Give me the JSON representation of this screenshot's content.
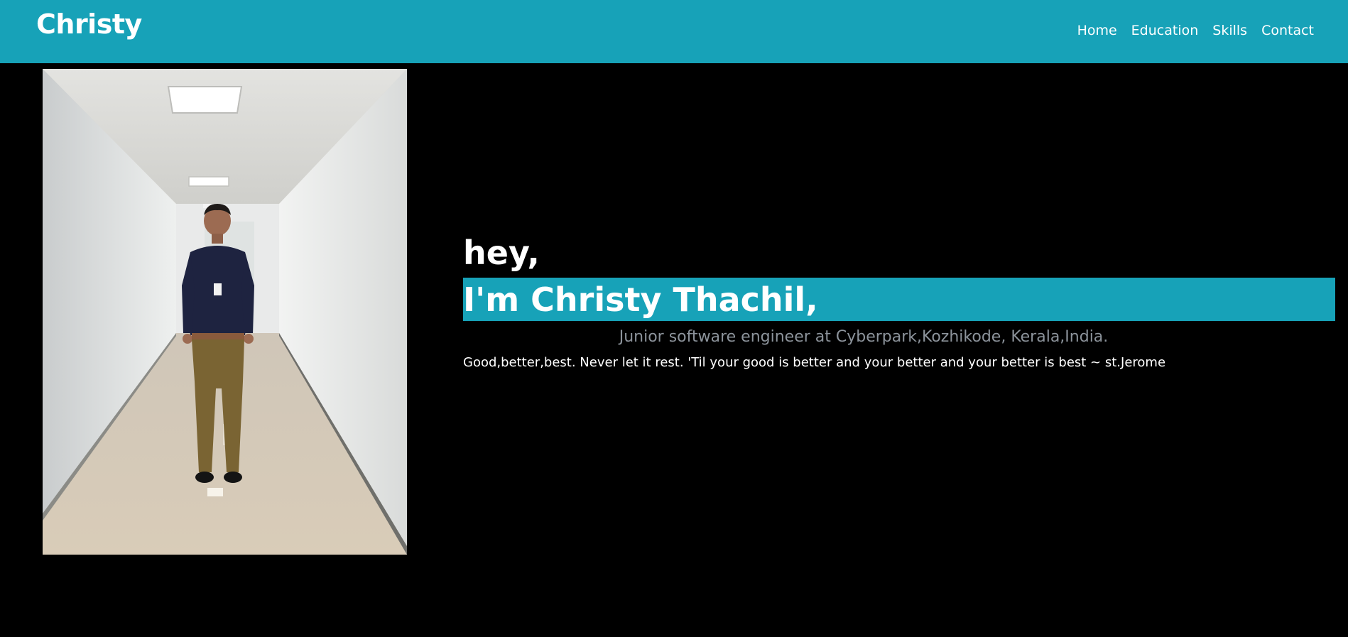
{
  "navbar": {
    "brand": "Christy",
    "links": [
      {
        "label": "Home"
      },
      {
        "label": "Education"
      },
      {
        "label": "Skills"
      },
      {
        "label": "Contact"
      }
    ],
    "background_color": "#17a2b8"
  },
  "hero": {
    "greeting": "hey,",
    "name": "I'm Christy Thachil,",
    "role": "Junior software engineer at Cyberpark,Kozhikode, Kerala,India.",
    "quote": "Good,better,best. Never let it rest. 'Til your good is better and your better and your better is best ~ st.Jerome",
    "accent_color": "#17a2b8",
    "role_color": "#8c939b"
  }
}
